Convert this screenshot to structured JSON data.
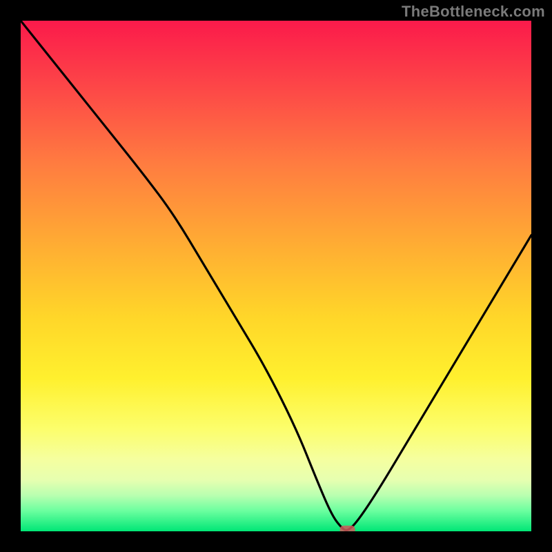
{
  "watermark": "TheBottleneck.com",
  "chart_data": {
    "type": "line",
    "title": "",
    "xlabel": "",
    "ylabel": "",
    "xlim": [
      0,
      100
    ],
    "ylim": [
      0,
      100
    ],
    "series": [
      {
        "name": "bottleneck-curve",
        "x": [
          0,
          8,
          16,
          24,
          30,
          36,
          42,
          48,
          54,
          58,
          61,
          63,
          64,
          66,
          70,
          76,
          82,
          88,
          94,
          100
        ],
        "y": [
          100,
          90,
          80,
          70,
          62,
          52,
          42,
          32,
          20,
          10,
          3,
          0.5,
          0,
          2,
          8,
          18,
          28,
          38,
          48,
          58
        ]
      }
    ],
    "marker": {
      "x": 64,
      "y": 0.3,
      "label": "optimal-point"
    },
    "gradient_stops": [
      {
        "pos": 0,
        "color": "#fb1a4b"
      },
      {
        "pos": 44,
        "color": "#ffad33"
      },
      {
        "pos": 70,
        "color": "#fff02e"
      },
      {
        "pos": 100,
        "color": "#00e676"
      }
    ]
  }
}
